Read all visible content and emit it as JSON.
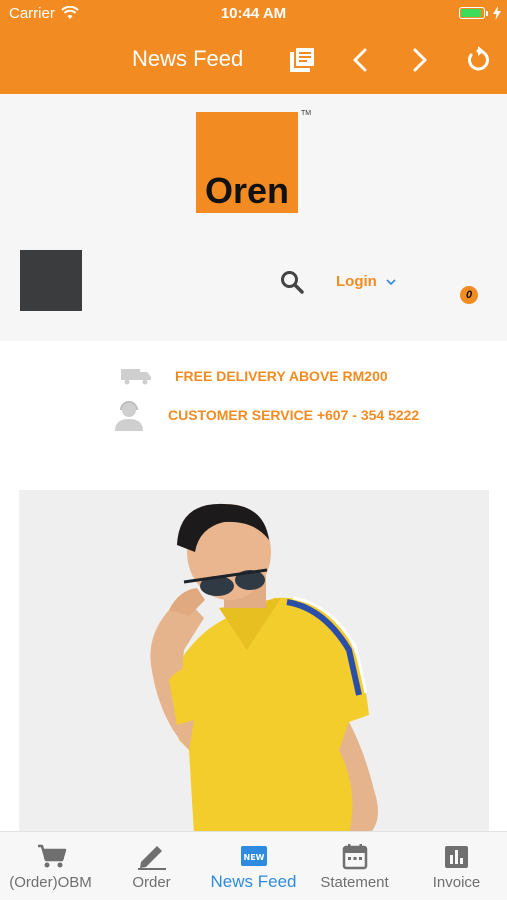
{
  "status_bar": {
    "carrier": "Carrier",
    "time": "10:44 AM"
  },
  "nav_bar": {
    "title": "News Feed"
  },
  "header": {
    "logo_text": "Oren",
    "logo_tm": "TM",
    "login_label": "Login",
    "cart_count": "0"
  },
  "info": {
    "delivery": "FREE DELIVERY ABOVE RM200",
    "service": "CUSTOMER SERVICE +607 - 354 5222"
  },
  "tab_bar": {
    "items": [
      {
        "label": "(Order)OBM",
        "icon": "cart-icon"
      },
      {
        "label": "Order",
        "icon": "pencil-icon"
      },
      {
        "label": "News Feed",
        "icon": "new-badge-icon",
        "badge": "NEW",
        "active": true
      },
      {
        "label": "Statement",
        "icon": "calendar-icon"
      },
      {
        "label": "Invoice",
        "icon": "bar-chart-icon"
      }
    ]
  },
  "colors": {
    "accent": "#f28c22",
    "active_tab": "#2f8bdf",
    "inactive_tab": "#6f6f6f"
  }
}
